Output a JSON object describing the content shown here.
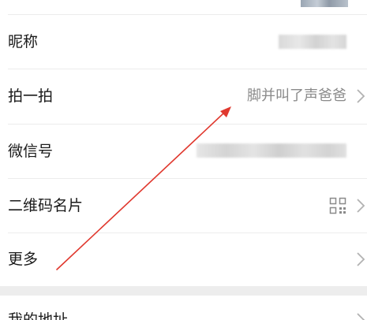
{
  "rows": [
    {
      "label": "昵称",
      "value": ""
    },
    {
      "label": "拍一拍",
      "value": "脚并叫了声爸爸"
    },
    {
      "label": "微信号",
      "value": ""
    },
    {
      "label": "二维码名片",
      "value": ""
    },
    {
      "label": "更多",
      "value": ""
    },
    {
      "label": "我的地址",
      "value": ""
    }
  ],
  "icons": {
    "chevron": "chevron-right-icon",
    "qr": "qr-code-icon"
  },
  "colors": {
    "annotation_arrow": "#e0382e",
    "section_gap": "#ededed",
    "secondary_text": "#8a8a8a"
  }
}
